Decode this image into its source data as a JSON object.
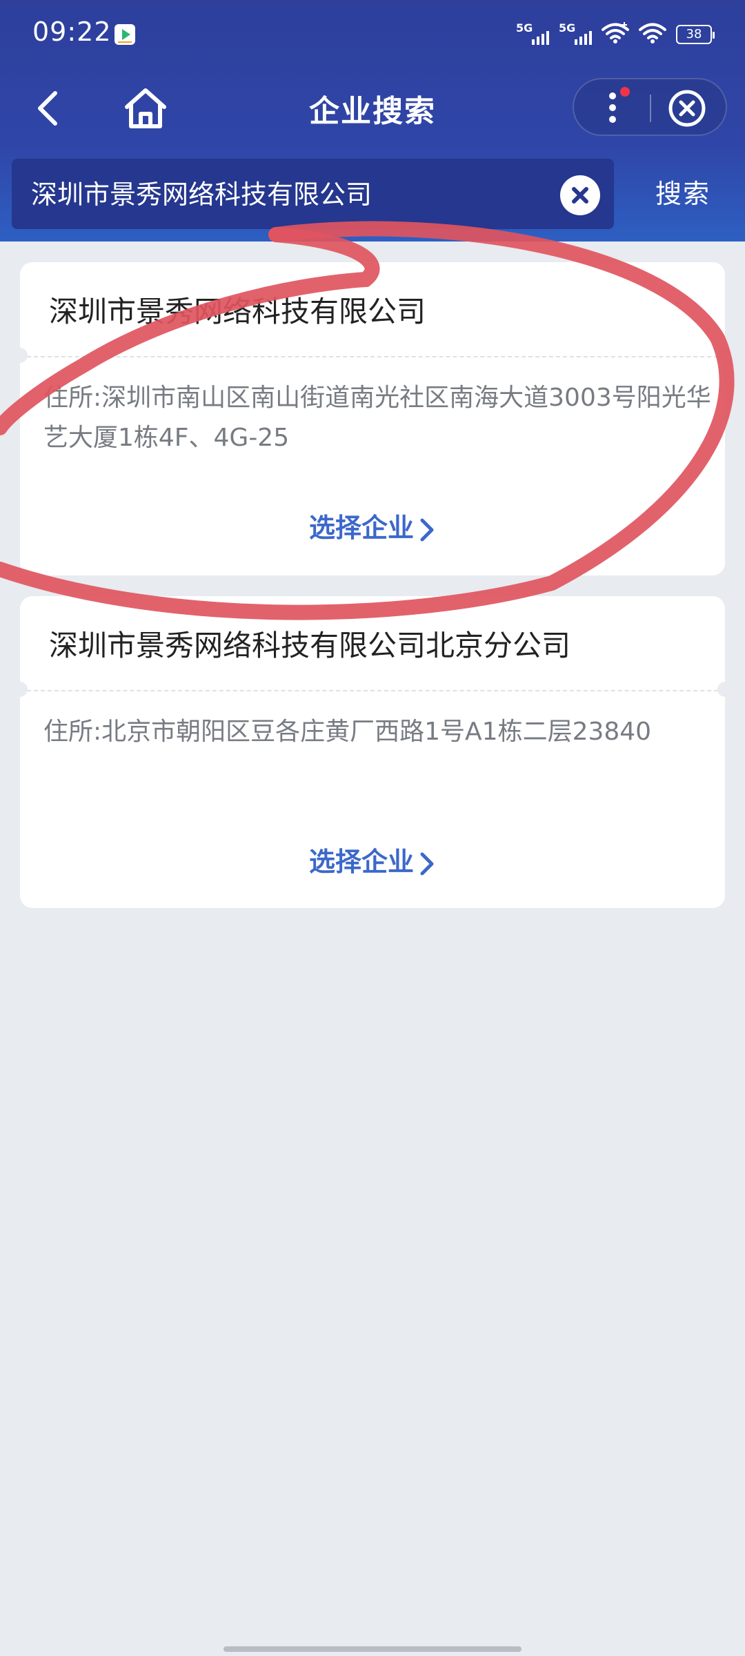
{
  "status_bar": {
    "time": "09:22",
    "network_1": "5G",
    "network_2": "5G",
    "battery": "38"
  },
  "nav": {
    "title": "企业搜索"
  },
  "search": {
    "value": "深圳市景秀网络科技有限公司",
    "button_label": "搜索"
  },
  "results": [
    {
      "name": "深圳市景秀网络科技有限公司",
      "address": "住所:深圳市南山区南山街道南光社区南海大道3003号阳光华艺大厦1栋4F、4G-25",
      "action_label": "选择企业"
    },
    {
      "name": "深圳市景秀网络科技有限公司北京分公司",
      "address": "住所:北京市朝阳区豆各庄黄厂西路1号A1栋二层23840",
      "action_label": "选择企业"
    }
  ],
  "colors": {
    "header": "#2e3f9c",
    "search_box": "#25378e",
    "link": "#3c68c9",
    "background": "#e8ebf0",
    "annotation": "#e05560"
  },
  "icons": {
    "back": "back-arrow-icon",
    "home": "home-icon",
    "more": "more-dots-icon",
    "close": "close-circle-icon",
    "clear": "clear-icon",
    "chevron": "chevron-right-icon"
  }
}
